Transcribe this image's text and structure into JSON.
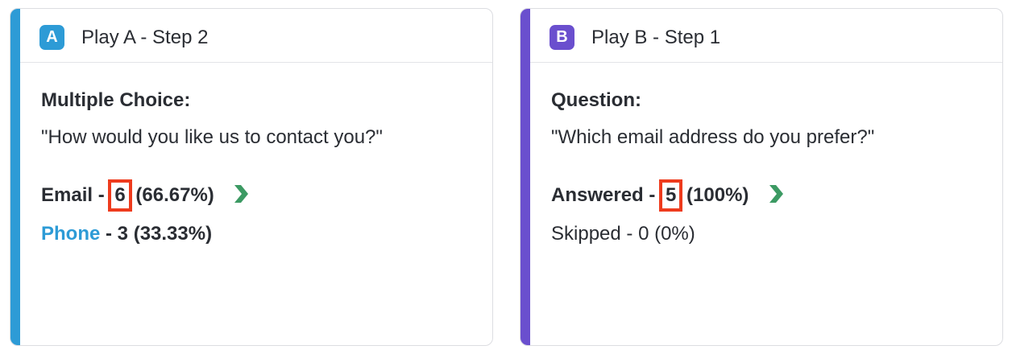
{
  "colors": {
    "accent_a": "#2d9bd6",
    "accent_b": "#6a4fce",
    "highlight": "#ee3b1d",
    "arrow": "#3c9a63",
    "link": "#2d9bd6"
  },
  "card_a": {
    "badge": "A",
    "title": "Play A - Step 2",
    "question_type": "Multiple Choice:",
    "question_text": "\"How would you like us to contact you?\"",
    "answers": [
      {
        "label": "Email",
        "sep": " - ",
        "count": "6",
        "percent": " (66.67%)"
      },
      {
        "label": "Phone",
        "sep": " - ",
        "count": "3",
        "percent": " (33.33%)"
      }
    ],
    "arrow_icon": "chevron-right-icon"
  },
  "card_b": {
    "badge": "B",
    "title": "Play B - Step 1",
    "question_type": "Question:",
    "question_text": "\"Which email address do you prefer?\"",
    "answers": [
      {
        "label": "Answered",
        "sep": " - ",
        "count": "5",
        "percent": " (100%)"
      },
      {
        "label": "Skipped",
        "sep": " - ",
        "count": "0",
        "percent": " (0%)"
      }
    ],
    "arrow_icon": "chevron-right-icon"
  }
}
